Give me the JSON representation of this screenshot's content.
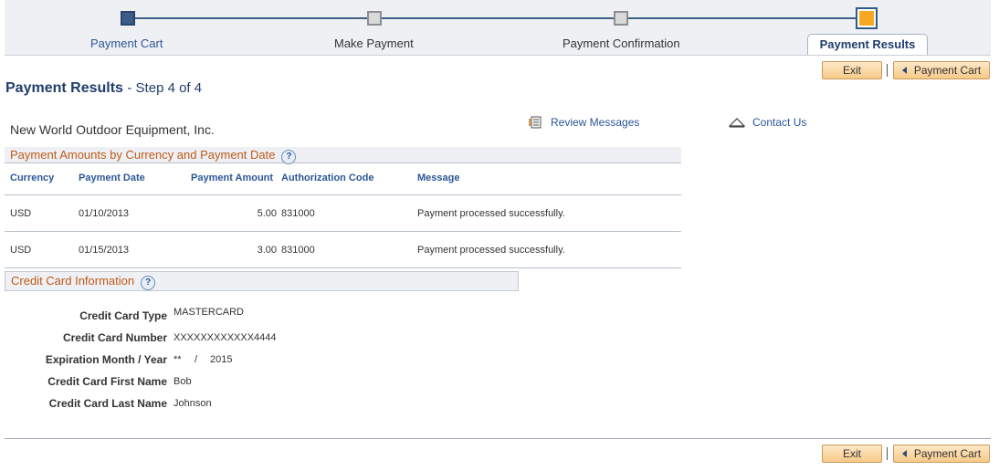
{
  "progress": {
    "steps": [
      {
        "label": "Payment Cart",
        "state": "done"
      },
      {
        "label": "Make Payment",
        "state": "todo"
      },
      {
        "label": "Payment Confirmation",
        "state": "todo"
      },
      {
        "label": "Payment Results",
        "state": "current"
      }
    ]
  },
  "toolbar": {
    "exit_label": "Exit",
    "back_label": "Payment Cart"
  },
  "page": {
    "title": "Payment Results",
    "step_text": "- Step 4 of 4"
  },
  "company": "New World Outdoor Equipment, Inc.",
  "links": {
    "review_messages": "Review Messages",
    "contact_us": "Contact Us"
  },
  "payments": {
    "title": "Payment Amounts by Currency and Payment Date",
    "columns": [
      "Currency",
      "Payment Date",
      "Payment Amount",
      "Authorization Code",
      "Message"
    ],
    "rows": [
      {
        "currency": "USD",
        "date": "01/10/2013",
        "amount": "5.00",
        "auth": "831000",
        "message": "Payment processed successfully."
      },
      {
        "currency": "USD",
        "date": "01/15/2013",
        "amount": "3.00",
        "auth": "831000",
        "message": "Payment processed successfully."
      }
    ]
  },
  "credit_card": {
    "title": "Credit Card Information",
    "type_label": "Credit Card Type",
    "type_value": "MASTERCARD",
    "number_label": "Credit Card Number",
    "number_value": "XXXXXXXXXXXX4444",
    "exp_label": "Expiration Month / Year",
    "exp_month": "**",
    "exp_sep": "/",
    "exp_year": "2015",
    "first_label": "Credit Card First Name",
    "first_value": "Bob",
    "last_label": "Credit Card Last Name",
    "last_value": "Johnson"
  },
  "help_glyph": "?",
  "colors": {
    "accent": "#2b5797",
    "section_title": "#c05a1a",
    "current_step": "#f7a823"
  }
}
